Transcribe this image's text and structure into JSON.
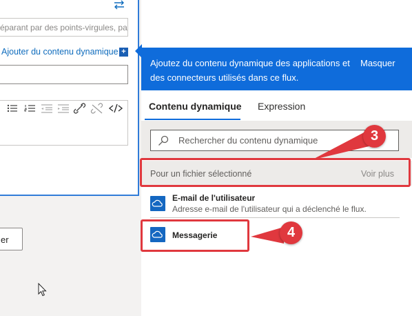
{
  "editor": {
    "emails_placeholder": "éparant par des points-virgules, pa",
    "add_dynamic_label": "Ajouter du contenu dynamique",
    "add_dynamic_plus": "+",
    "ghost_button_label": "er"
  },
  "flyout": {
    "header_text": "Ajoutez du contenu dynamique des applications et des connecteurs utilisés dans ce flux.",
    "hide_label": "Masquer",
    "tabs": [
      {
        "label": "Contenu dynamique",
        "active": true
      },
      {
        "label": "Expression",
        "active": false
      }
    ],
    "search_placeholder": "Rechercher du contenu dynamique",
    "section": {
      "title": "Pour un fichier sélectionné",
      "see_more": "Voir plus"
    },
    "items": [
      {
        "title": "E-mail de l'utilisateur",
        "description": "Adresse e-mail de l'utilisateur qui a déclenché le flux.",
        "icon": "cloud-icon"
      },
      {
        "title": "Messagerie",
        "description": "",
        "icon": "cloud-icon"
      }
    ]
  },
  "callouts": [
    {
      "number": "3"
    },
    {
      "number": "4"
    }
  ],
  "colors": {
    "accent": "#0f6cdb",
    "callout_red": "#e0383e"
  }
}
